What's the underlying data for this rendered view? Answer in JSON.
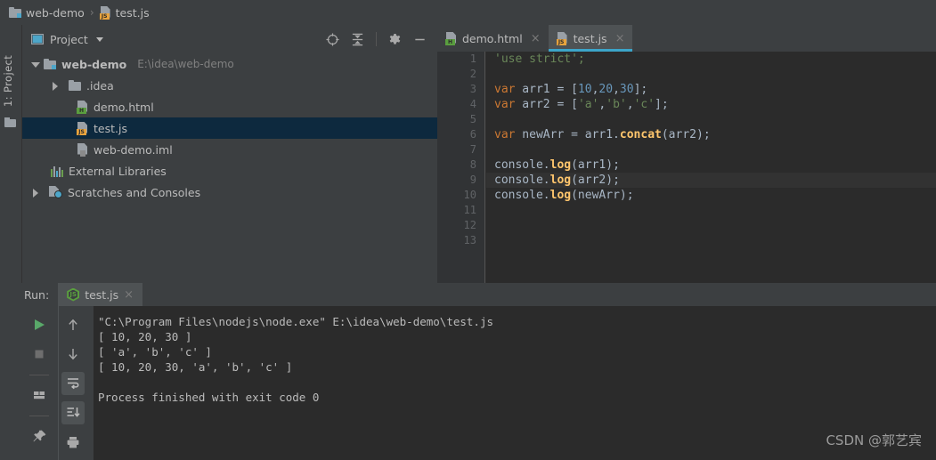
{
  "breadcrumb": {
    "project": "web-demo",
    "separator": "›",
    "file": "test.js",
    "file_badge": "JS"
  },
  "tool_stripe": {
    "label": "1: Project",
    "folder_icon": "folder-icon"
  },
  "project_panel": {
    "title": "Project",
    "icons": [
      "locate-target-icon",
      "collapse-all-icon",
      "settings-gear-icon",
      "minimize-icon"
    ],
    "tree": [
      {
        "label": "web-demo",
        "path": "E:\\idea\\web-demo",
        "icon": "folder-module-icon",
        "indent": 0,
        "arrow": "down",
        "bold": true,
        "selected": false
      },
      {
        "label": ".idea",
        "path": "",
        "icon": "folder-icon",
        "indent": 1,
        "arrow": "right",
        "bold": false,
        "selected": false
      },
      {
        "label": "demo.html",
        "path": "",
        "icon": "html-file-icon",
        "badge": "H",
        "indent": 2,
        "arrow": "none",
        "bold": false,
        "selected": false
      },
      {
        "label": "test.js",
        "path": "",
        "icon": "js-file-icon",
        "badge": "JS",
        "indent": 2,
        "arrow": "none",
        "bold": false,
        "selected": true
      },
      {
        "label": "web-demo.iml",
        "path": "",
        "icon": "iml-file-icon",
        "badge": "",
        "indent": 2,
        "arrow": "none",
        "bold": false,
        "selected": false
      },
      {
        "label": "External Libraries",
        "path": "",
        "icon": "libraries-icon",
        "indent": 1,
        "arrow": "none",
        "bold": false,
        "selected": false
      },
      {
        "label": "Scratches and Consoles",
        "path": "",
        "icon": "scratches-icon",
        "indent": 0,
        "arrow": "right",
        "bold": false,
        "selected": false
      }
    ]
  },
  "editor": {
    "tabs": [
      {
        "label": "demo.html",
        "badge": "H",
        "active": false,
        "close": "×"
      },
      {
        "label": "test.js",
        "badge": "JS",
        "active": true,
        "close": "×"
      }
    ],
    "line_numbers": [
      "1",
      "2",
      "3",
      "4",
      "5",
      "6",
      "7",
      "8",
      "9",
      "10",
      "11",
      "12",
      "13"
    ],
    "current_line": 9,
    "colors": {
      "background": "#2B2B2B",
      "gutter": "#313335",
      "keyword": "#CC7832",
      "string": "#6A8759",
      "number": "#6897BB",
      "function": "#FFC66D",
      "plain": "#A9B7C6",
      "active_tab_underline": "#3CA5C9"
    },
    "code_lines": [
      [
        {
          "t": "'use strict';",
          "c": "str"
        }
      ],
      [],
      [
        {
          "t": "var",
          "c": "kw"
        },
        {
          "t": " arr1 = [",
          "c": "pl"
        },
        {
          "t": "10",
          "c": "num"
        },
        {
          "t": ",",
          "c": "pl"
        },
        {
          "t": "20",
          "c": "num"
        },
        {
          "t": ",",
          "c": "pl"
        },
        {
          "t": "30",
          "c": "num"
        },
        {
          "t": "];",
          "c": "pl"
        }
      ],
      [
        {
          "t": "var",
          "c": "kw"
        },
        {
          "t": " arr2 = [",
          "c": "pl"
        },
        {
          "t": "'a'",
          "c": "str"
        },
        {
          "t": ",",
          "c": "pl"
        },
        {
          "t": "'b'",
          "c": "str"
        },
        {
          "t": ",",
          "c": "pl"
        },
        {
          "t": "'c'",
          "c": "str"
        },
        {
          "t": "];",
          "c": "pl"
        }
      ],
      [],
      [
        {
          "t": "var",
          "c": "kw"
        },
        {
          "t": " newArr = arr1.",
          "c": "pl"
        },
        {
          "t": "concat",
          "c": "fn"
        },
        {
          "t": "(arr2);",
          "c": "pl"
        }
      ],
      [],
      [
        {
          "t": "console.",
          "c": "pl"
        },
        {
          "t": "log",
          "c": "fn"
        },
        {
          "t": "(arr1);",
          "c": "pl"
        }
      ],
      [
        {
          "t": "console.",
          "c": "pl"
        },
        {
          "t": "log",
          "c": "fn"
        },
        {
          "t": "(arr2);",
          "c": "pl"
        }
      ],
      [
        {
          "t": "console.",
          "c": "pl"
        },
        {
          "t": "log",
          "c": "fn"
        },
        {
          "t": "(newArr);",
          "c": "pl"
        }
      ],
      [],
      [],
      []
    ]
  },
  "run_panel": {
    "label": "Run:",
    "tab_label": "test.js",
    "tab_close": "×",
    "toolbar_left": [
      "run-play-icon",
      "stop-icon",
      "layout-icon",
      "pin-icon"
    ],
    "toolbar_right": [
      "arrow-up-icon",
      "arrow-down-icon",
      "soft-wrap-icon",
      "scroll-to-end-icon",
      "print-icon"
    ],
    "console_lines": [
      "\"C:\\Program Files\\nodejs\\node.exe\" E:\\idea\\web-demo\\test.js",
      "[ 10, 20, 30 ]",
      "[ 'a', 'b', 'c' ]",
      "[ 10, 20, 30, 'a', 'b', 'c' ]",
      "",
      "Process finished with exit code 0"
    ]
  },
  "watermark": {
    "text": "CSDN @郭艺宾"
  }
}
